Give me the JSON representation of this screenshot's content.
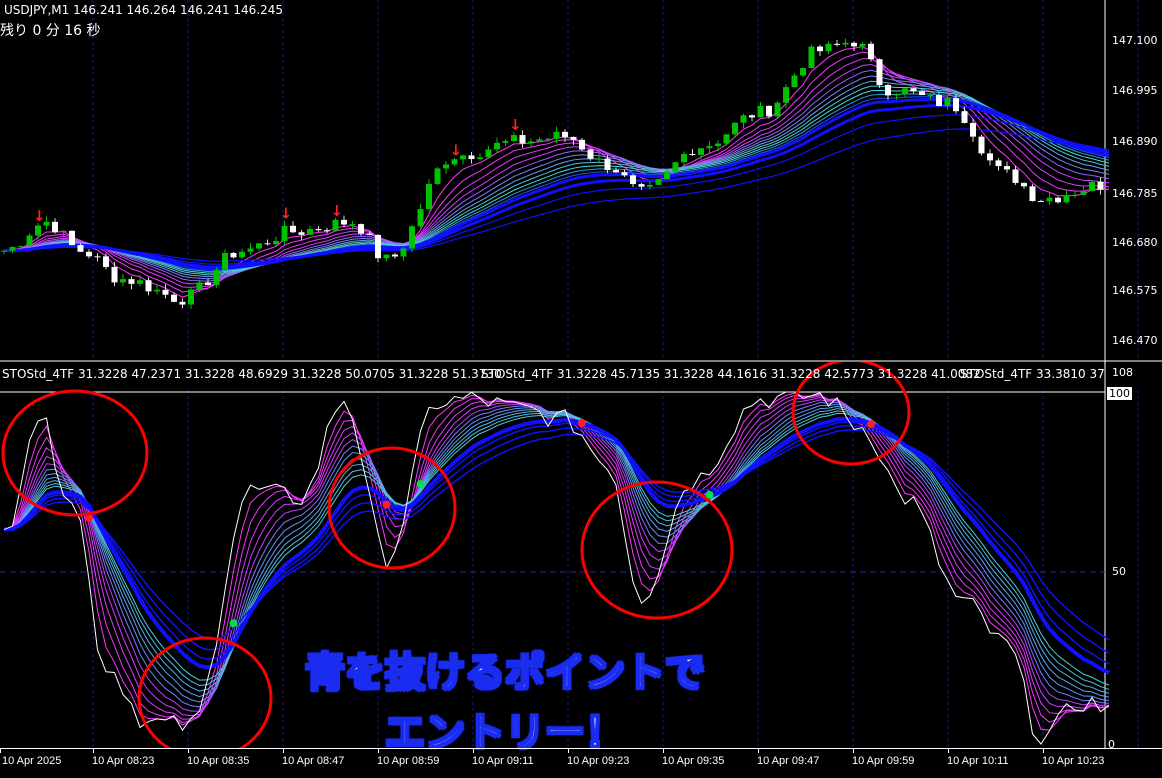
{
  "header": {
    "symbol_line": "USDJPY,M1  146.241 146.264 146.241 146.245",
    "remaining_label": "残り 0 分 16 秒"
  },
  "price_axis": [
    "147.100",
    "146.995",
    "146.890",
    "146.785",
    "146.680",
    "146.575",
    "146.470"
  ],
  "indicator": {
    "header_1": "STOStd_4TF 31.3228 47.2371 31.3228 48.6929 31.3228 50.0705 31.3228 51.3730",
    "header_2": "STOStd_4TF 31.3228 45.7135 31.3228 44.1616 31.3228 42.5773 31.3228 41.0082",
    "header_3": "STOStd_4TF 33.3810 37.",
    "axis": [
      "108",
      "100",
      "50",
      "0"
    ]
  },
  "time_axis": [
    "10 Apr 2025",
    "10 Apr 08:23",
    "10 Apr 08:35",
    "10 Apr 08:47",
    "10 Apr 08:59",
    "10 Apr 09:11",
    "10 Apr 09:23",
    "10 Apr 09:35",
    "10 Apr 09:47",
    "10 Apr 09:59",
    "10 Apr 10:11",
    "10 Apr 10:23"
  ],
  "annotation": {
    "line1": "青を抜けるポイントで",
    "line2": "エントリー！"
  },
  "colors": {
    "bull": "#00c000",
    "bear": "#ffffff",
    "ribbon_fast": "#ff33ff",
    "ribbon_mid": "#40e0d0",
    "ribbon_slow": "#1010ff",
    "circle": "#ff0000",
    "up_arrow": "#1e90ff",
    "down_arrow": "#ff2020"
  },
  "chart_data": {
    "type": "line",
    "price_range": [
      146.43,
      147.16
    ],
    "price_path": [
      [
        0,
        146.66
      ],
      [
        5,
        146.72
      ],
      [
        9,
        146.66
      ],
      [
        14,
        146.6
      ],
      [
        21,
        146.56
      ],
      [
        28,
        146.66
      ],
      [
        34,
        146.7
      ],
      [
        41,
        146.72
      ],
      [
        45,
        146.64
      ],
      [
        53,
        146.86
      ],
      [
        61,
        146.89
      ],
      [
        66,
        146.9
      ],
      [
        71,
        146.84
      ],
      [
        75,
        146.78
      ],
      [
        82,
        146.88
      ],
      [
        89,
        146.95
      ],
      [
        96,
        147.08
      ],
      [
        100,
        147.1
      ],
      [
        104,
        147.0
      ],
      [
        111,
        146.97
      ],
      [
        118,
        146.82
      ],
      [
        122,
        146.77
      ],
      [
        130,
        146.8
      ]
    ],
    "stoch_range": [
      0,
      108
    ],
    "stoch_path": [
      [
        0,
        60
      ],
      [
        4,
        93
      ],
      [
        8,
        70
      ],
      [
        12,
        22
      ],
      [
        17,
        6
      ],
      [
        22,
        5
      ],
      [
        29,
        72
      ],
      [
        35,
        70
      ],
      [
        40,
        98
      ],
      [
        45,
        53
      ],
      [
        51,
        97
      ],
      [
        55,
        98
      ],
      [
        61,
        95
      ],
      [
        66,
        92
      ],
      [
        71,
        80
      ],
      [
        75,
        42
      ],
      [
        81,
        75
      ],
      [
        89,
        98
      ],
      [
        96,
        99
      ],
      [
        101,
        90
      ],
      [
        106,
        70
      ],
      [
        113,
        40
      ],
      [
        118,
        28
      ],
      [
        122,
        2
      ],
      [
        127,
        12
      ],
      [
        130,
        10
      ]
    ]
  }
}
